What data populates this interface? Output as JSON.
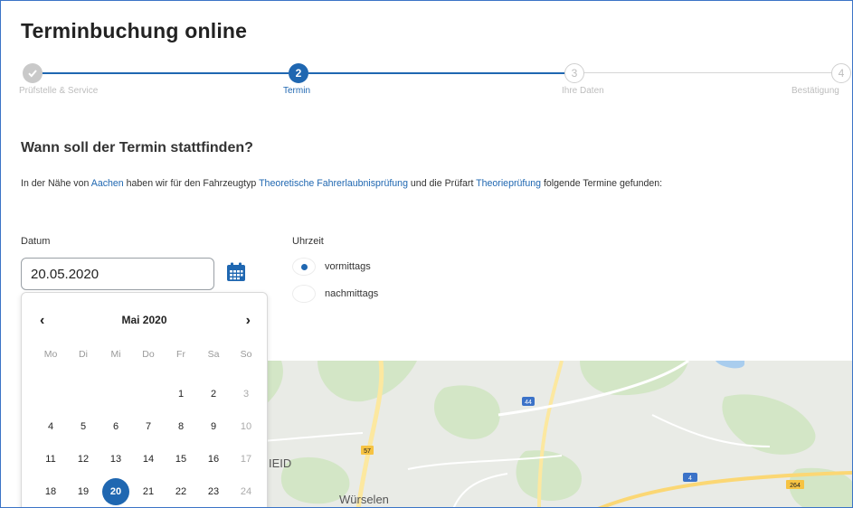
{
  "page": {
    "title": "Terminbuchung online"
  },
  "stepper": {
    "steps": [
      {
        "number": "",
        "label": "Prüfstelle & Service",
        "state": "done"
      },
      {
        "number": "2",
        "label": "Termin",
        "state": "active"
      },
      {
        "number": "3",
        "label": "Ihre Daten",
        "state": "todo"
      },
      {
        "number": "4",
        "label": "Bestätigung",
        "state": "todo"
      }
    ]
  },
  "section": {
    "heading": "Wann soll der Termin stattfinden?",
    "intro": {
      "p1": "In der Nähe von ",
      "location": "Aachen",
      "p2": " haben wir für den Fahrzeugtyp ",
      "vehicle": "Theoretische Fahrerlaubnisprüfung",
      "p3": " und die Prüfart ",
      "exam": "Theorieprüfung",
      "p4": " folgende Termine gefunden:"
    }
  },
  "form": {
    "datum_label": "Datum",
    "datum_value": "20.05.2020",
    "uhrzeit_label": "Uhrzeit",
    "options": [
      {
        "label": "vormittags",
        "selected": true
      },
      {
        "label": "nachmittags",
        "selected": false
      }
    ]
  },
  "calendar": {
    "prev": "‹",
    "next": "›",
    "month": "Mai 2020",
    "weekdays": [
      "Mo",
      "Di",
      "Mi",
      "Do",
      "Fr",
      "Sa",
      "So"
    ],
    "weeks": [
      [
        "",
        "",
        "",
        "",
        "1",
        "2",
        "3"
      ],
      [
        "4",
        "5",
        "6",
        "7",
        "8",
        "9",
        "10"
      ],
      [
        "11",
        "12",
        "13",
        "14",
        "15",
        "16",
        "17"
      ],
      [
        "18",
        "19",
        "20",
        "21",
        "22",
        "23",
        "24"
      ]
    ],
    "selected_day": "20"
  },
  "map": {
    "labels": [
      "IEID",
      "Würselen"
    ],
    "road_shields": [
      "44",
      "57",
      "4",
      "264"
    ]
  },
  "colors": {
    "accent": "#1f67b1",
    "inactive": "#c9c9c9"
  }
}
